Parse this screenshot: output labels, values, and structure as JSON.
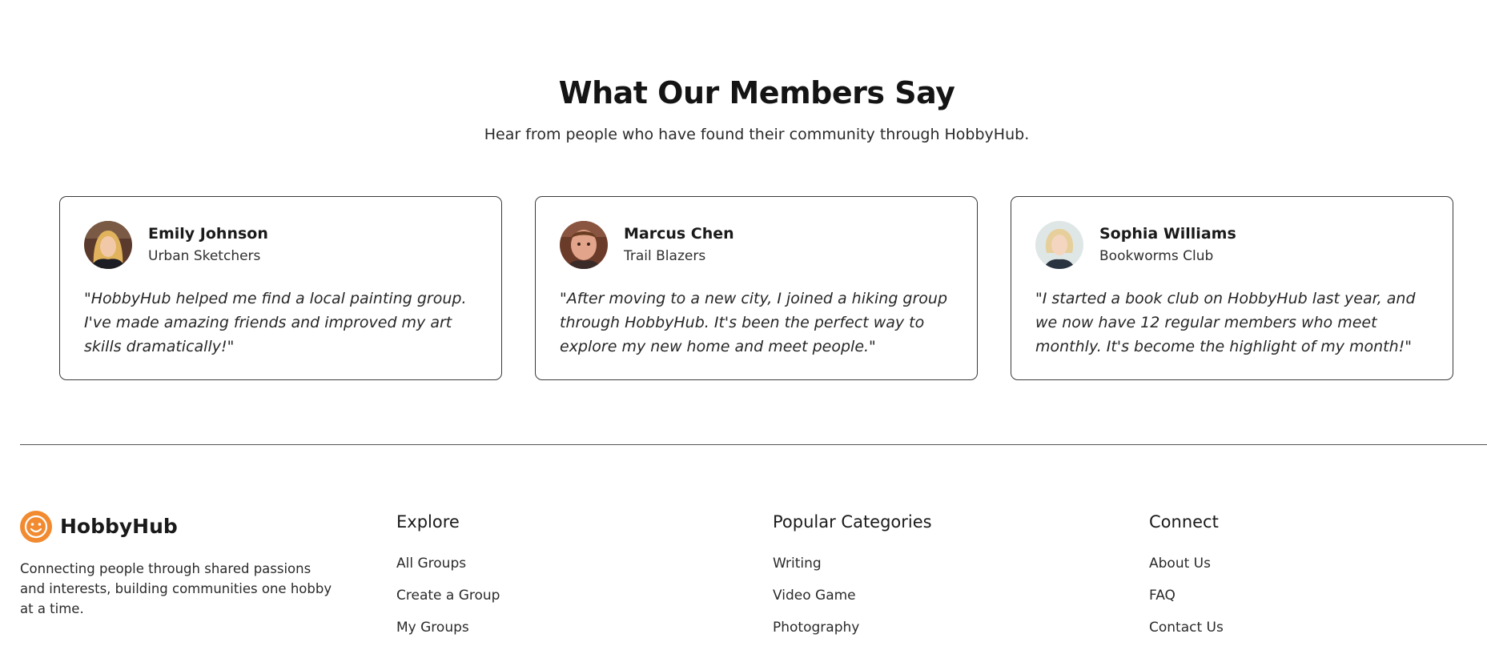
{
  "section": {
    "title": "What Our Members Say",
    "subtitle": "Hear from people who have found their community through HobbyHub."
  },
  "testimonials": [
    {
      "name": "Emily Johnson",
      "group": "Urban Sketchers",
      "quote": "\"HobbyHub helped me find a local painting group. I've made amazing friends and improved my art skills dramatically!\""
    },
    {
      "name": "Marcus Chen",
      "group": "Trail Blazers",
      "quote": "\"After moving to a new city, I joined a hiking group through HobbyHub. It's been the perfect way to explore my new home and meet people.\""
    },
    {
      "name": "Sophia Williams",
      "group": "Bookworms Club",
      "quote": "\"I started a book club on HobbyHub last year, and we now have 12 regular members who meet monthly. It's become the highlight of my month!\""
    }
  ],
  "footer": {
    "brand": {
      "name": "HobbyHub",
      "description": "Connecting people through shared passions and interests, building communities one hobby at a time.",
      "logo_icon": "smiley-icon",
      "logo_color": "#F28A30"
    },
    "columns": [
      {
        "heading": "Explore",
        "links": [
          "All Groups",
          "Create a Group",
          "My Groups"
        ]
      },
      {
        "heading": "Popular Categories",
        "links": [
          "Writing",
          "Video Game",
          "Photography"
        ]
      },
      {
        "heading": "Connect",
        "links": [
          "About Us",
          "FAQ",
          "Contact Us"
        ]
      }
    ]
  }
}
